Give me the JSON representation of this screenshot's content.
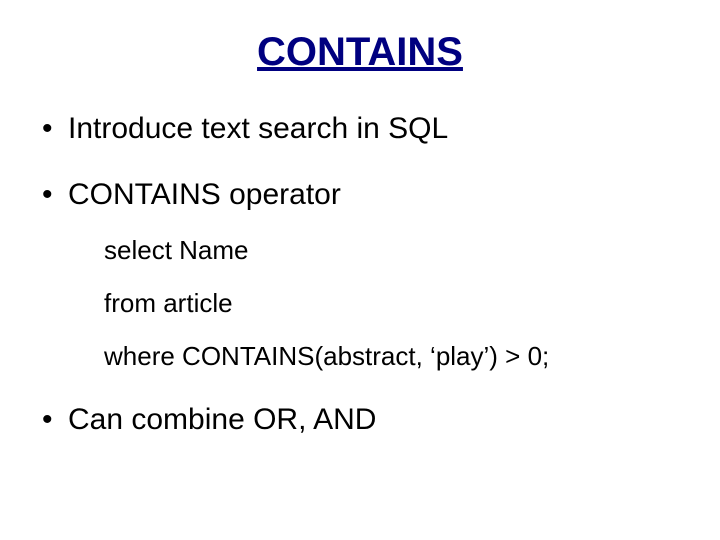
{
  "title": "CONTAINS",
  "bullets": {
    "b1": "Introduce text search in SQL",
    "b2": "CONTAINS operator",
    "b3": "Can combine OR, AND"
  },
  "code": {
    "l1": "select Name",
    "l2": "from article",
    "l3": "where CONTAINS(abstract, ‘play’) > 0;"
  }
}
